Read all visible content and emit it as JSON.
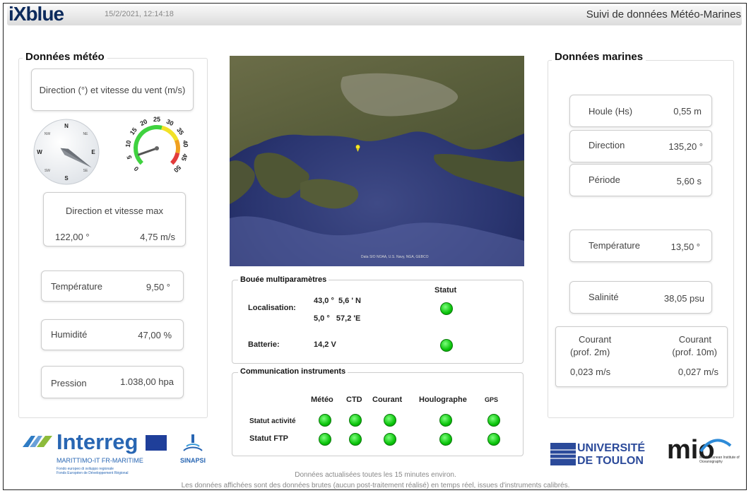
{
  "header": {
    "logo": "iXblue",
    "datetime": "15/2/2021, 12:14:18",
    "title": "Suivi de données Météo-Marines"
  },
  "meteo": {
    "title": "Données météo",
    "wind_label": "Direction (°) et vitesse du vent (m/s)",
    "compass": {
      "n": "N",
      "s": "S",
      "e": "E",
      "w": "W",
      "ne": "NE",
      "nw": "NW",
      "se": "SE",
      "sw": "SW",
      "direction_deg": 122
    },
    "gauge": {
      "ticks": [
        "0",
        "5",
        "10",
        "15",
        "20",
        "25",
        "30",
        "35",
        "40",
        "45",
        "50"
      ],
      "value": 4.75,
      "max": 50
    },
    "max_label": "Direction et vitesse max",
    "max_dir": "122,00 °",
    "max_speed": "4,75 m/s",
    "temp_label": "Température",
    "temp_value": "9,50 °",
    "hum_label": "Humidité",
    "hum_value": "47,00 %",
    "press_label": "Pression",
    "press_value": "1.038,00 hpa"
  },
  "map": {
    "credit": "Data SIO NOAA, U.S. Navy, NGA, GEBCO"
  },
  "buoy": {
    "title": "Bouée multiparamètres",
    "statut_label": "Statut",
    "loc_label": "Localisation:",
    "lat": "43,0 °  5,6 ' N",
    "lon": "5,0 °   57,2 'E",
    "bat_label": "Batterie:",
    "bat_value": "14,2 V",
    "status_color": "#0bc40b"
  },
  "comm": {
    "title": "Communication instruments",
    "cols": [
      "Météo",
      "CTD",
      "Courant",
      "Houlographe",
      "GPS"
    ],
    "row1": "Statut activité",
    "row2": "Statut FTP"
  },
  "marine": {
    "title": "Données marines",
    "houle_label": "Houle (Hs)",
    "houle_value": "0,55 m",
    "dir_label": "Direction",
    "dir_value": "135,20 °",
    "per_label": "Période",
    "per_value": "5,60 s",
    "temp_label": "Température",
    "temp_value": "13,50 °",
    "sal_label": "Salinité",
    "sal_value": "38,05 psu",
    "c2_label1": "Courant",
    "c2_label2": "(prof. 2m)",
    "c2_value": "0,023 m/s",
    "c10_label1": "Courant",
    "c10_label2": "(prof. 10m)",
    "c10_value": "0,027 m/s"
  },
  "logos": {
    "interreg": "Interreg",
    "interreg_sub": "MARITTIMO-IT FR-MARITIME",
    "interreg_small1": "Fondo europeo di sviluppo regionale",
    "interreg_small2": "Fonds Européen de Développement Régional",
    "sinapsi": "SINAPSI",
    "univ1": "UNIVERSITÉ",
    "univ2": "DE TOULON",
    "mio": "mio",
    "mio_sub": "Mediterranean Institute of Oceanography"
  },
  "footer": {
    "line1": "Données actualisées toutes les 15 minutes environ.",
    "line2": "Les données affichées sont des données brutes (aucun post-traitement réalisé) en temps réel, issues d'instruments calibrés."
  }
}
